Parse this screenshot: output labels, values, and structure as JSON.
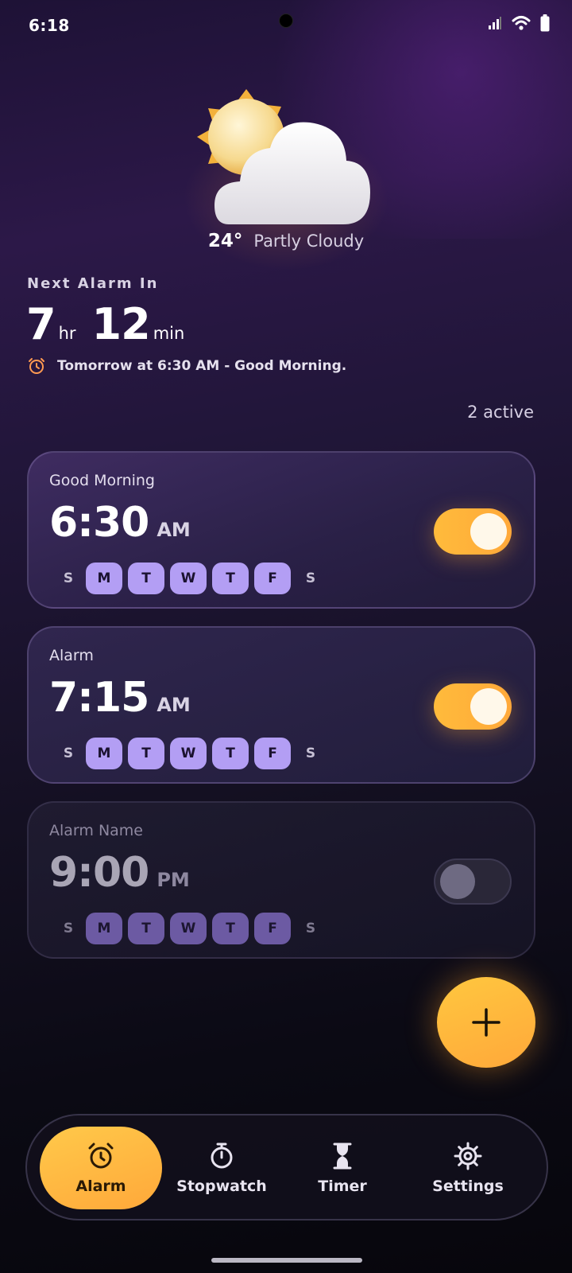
{
  "status_bar": {
    "time": "6:18"
  },
  "weather": {
    "temperature": "24°",
    "condition": "Partly Cloudy",
    "icon": "partly-cloudy-icon"
  },
  "next_alarm": {
    "label": "Next Alarm In",
    "hours": "7",
    "hours_unit": "hr",
    "minutes": "12",
    "minutes_unit": "min",
    "detail": "Tomorrow at 6:30 AM - Good Morning."
  },
  "active_count": "2 active",
  "alarms": [
    {
      "name": "Good Morning",
      "time": "6:30",
      "period": "AM",
      "enabled": true,
      "days": [
        "S",
        "M",
        "T",
        "W",
        "T",
        "F",
        "S"
      ],
      "active_days": [
        false,
        true,
        true,
        true,
        true,
        true,
        false
      ]
    },
    {
      "name": "Alarm",
      "time": "7:15",
      "period": "AM",
      "enabled": true,
      "days": [
        "S",
        "M",
        "T",
        "W",
        "T",
        "F",
        "S"
      ],
      "active_days": [
        false,
        true,
        true,
        true,
        true,
        true,
        false
      ]
    },
    {
      "name": "Alarm Name",
      "time": "9:00",
      "period": "PM",
      "enabled": false,
      "days": [
        "S",
        "M",
        "T",
        "W",
        "T",
        "F",
        "S"
      ],
      "active_days": [
        false,
        true,
        true,
        true,
        true,
        true,
        false
      ]
    }
  ],
  "nav": {
    "alarm": "Alarm",
    "stopwatch": "Stopwatch",
    "timer": "Timer",
    "settings": "Settings"
  },
  "colors": {
    "accent": "#ffb63c",
    "day_active": "#b39ef4",
    "background": "#1e1236"
  }
}
